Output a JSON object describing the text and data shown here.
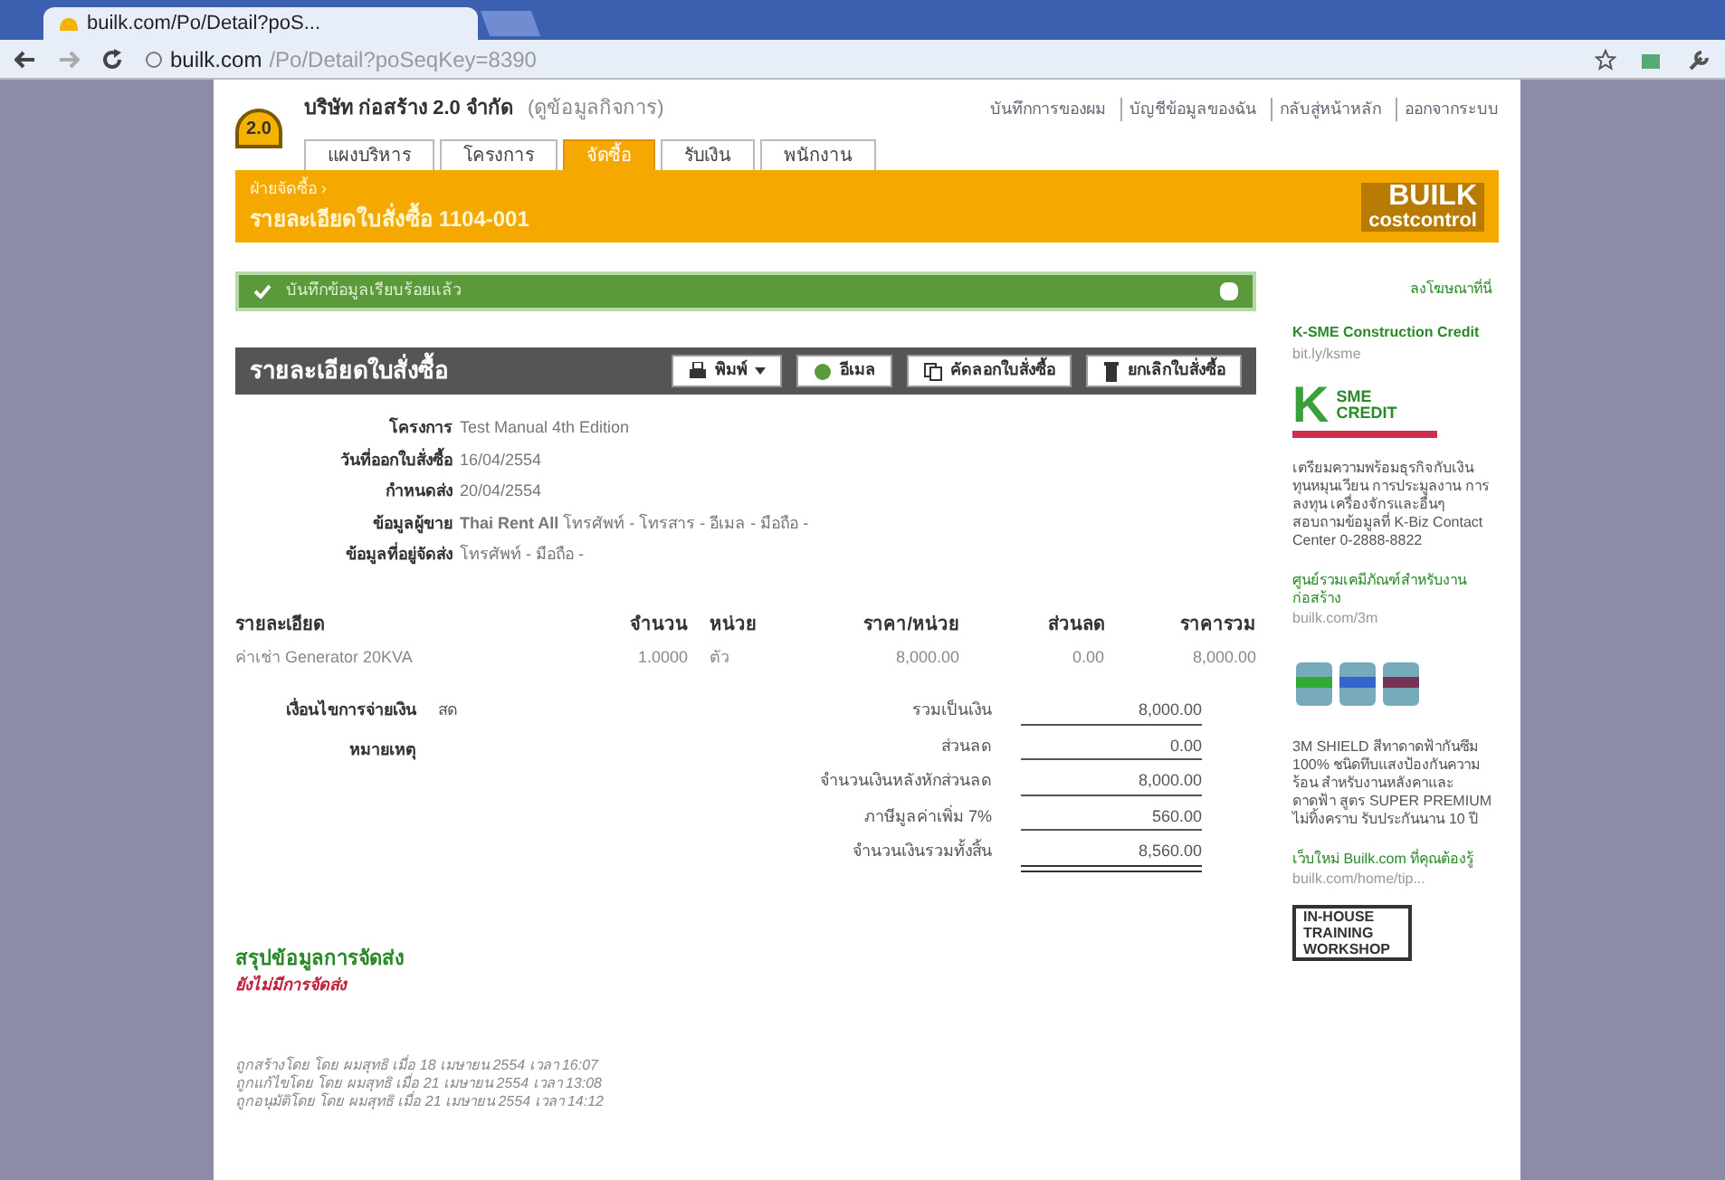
{
  "browser": {
    "tab_title": "builk.com/Po/Detail?poS...",
    "url_host": "builk.com",
    "url_path": "/Po/Detail?poSeqKey=8390"
  },
  "header": {
    "logo_badge": "2.0",
    "company": "บริษัท ก่อสร้าง 2.0 จำกัด",
    "company_link": "(ดูข้อมูลกิจการ)",
    "top_links": [
      "บันทึกการของผม",
      "บัญชีข้อมูลของฉัน",
      "กลับสู่หน้าหลัก",
      "ออกจากระบบ"
    ],
    "tabs": [
      {
        "label": "แผงบริหาร",
        "selected": false
      },
      {
        "label": "โครงการ",
        "selected": false
      },
      {
        "label": "จัดซื้อ",
        "selected": true
      },
      {
        "label": "รับเงิน",
        "selected": false
      },
      {
        "label": "พนักงาน",
        "selected": false
      }
    ],
    "breadcrumb": "ฝ่ายจัดซื้อ ›",
    "page_title": "รายละเอียดใบสั่งซื้อ 1104-001",
    "brand_top": "BUILK",
    "brand_bottom": "costcontrol"
  },
  "alert": {
    "text": "บันทึกข้อมูลเรียบร้อยแล้ว"
  },
  "panel": {
    "title": "รายละเอียดใบสั่งซื้อ",
    "buttons": [
      {
        "label": "พิมพ์",
        "kind": "print"
      },
      {
        "label": "อีเมล",
        "kind": "email"
      },
      {
        "label": "คัดลอกใบสั่งซื้อ",
        "kind": "copy"
      },
      {
        "label": "ยกเลิกใบสั่งซื้อ",
        "kind": "delete"
      }
    ]
  },
  "fields": [
    {
      "label": "โครงการ",
      "value": "Test Manual 4th Edition"
    },
    {
      "label": "วันที่ออกใบสั่งซื้อ",
      "value": "16/04/2554"
    },
    {
      "label": "กำหนดส่ง",
      "value": "20/04/2554"
    },
    {
      "label": "ข้อมูลผู้ขาย",
      "value": "**Thai Rent All** โทรศัพท์ - โทรสาร - อีเมล - มือถือ -"
    },
    {
      "label": "ข้อมูลที่อยู่จัดส่ง",
      "value": "โทรศัพท์ - มือถือ -"
    }
  ],
  "table": {
    "columns": [
      "รายละเอียด",
      "จำนวน",
      "หน่วย",
      "ราคา/หน่วย",
      "ส่วนลด",
      "ราคารวม"
    ],
    "rows": [
      [
        "ค่าเช่า Generator 20KVA",
        "1.0000",
        "ตัว",
        "8,000.00",
        "0.00",
        "8,000.00"
      ]
    ]
  },
  "terms": [
    {
      "label": "เงื่อนไขการจ่ายเงิน",
      "value": "สด"
    },
    {
      "label": "หมายเหตุ"
    }
  ],
  "totals": [
    {
      "label": "รวมเป็นเงิน",
      "value": "8,000.00"
    },
    {
      "label": "ส่วนลด",
      "value": "0.00"
    },
    {
      "label": "จำนวนเงินหลังหักส่วนลด",
      "value": "8,000.00"
    },
    {
      "label": "ภาษีมูลค่าเพิ่ม 7%",
      "value": "560.00"
    },
    {
      "label": "จำนวนเงินรวมทั้งสิ้น",
      "value": "8,560.00"
    }
  ],
  "delivery": {
    "title": "สรุปข้อมูลการจัดส่ง",
    "status": "ยังไม่มีการจัดส่ง"
  },
  "log": [
    "ถูกสร้างโดย โดย ผมสุทธิ เมื่อ 18 เมษายน 2554 เวลา 16:07",
    "ถูกแก้ไขโดย โดย ผมสุทธิ เมื่อ 21 เมษายน 2554 เวลา 13:08",
    "ถูกอนุมัติโดย โดย ผมสุทธิ เมื่อ 21 เมษายน 2554 เวลา 14:12"
  ],
  "sidebar": {
    "heading": "ลงโฆษณาที่นี่",
    "ads": [
      {
        "kind": "ksme",
        "title": "K-SME Construction Credit",
        "url": "bit.ly/ksme",
        "logo_mark": "K",
        "logo_top": "SME",
        "logo_bottom": "CREDIT",
        "text": "เตรียมความพร้อมธุรกิจกับเงินทุนหมุนเวียน การประมูลงาน การลงทุน เครื่องจักรและอื่นๆ สอบถามข้อมูลที่ K-Biz Contact Center 0-2888-8822"
      },
      {
        "kind": "paint",
        "title": "ศูนย์รวมเคมีภัณฑ์สำหรับงานก่อสร้าง",
        "url": "builk.com/3m",
        "text": "3M SHIELD สีทาดาดฟ้ากันซึม 100% ชนิดทึบแสงป้องกันความร้อน สำหรับงานหลังคาและดาดฟ้า สูตร SUPER PREMIUM ไม่ทิ้งคราบ รับประกันนาน 10 ปี"
      },
      {
        "kind": "training",
        "title": "เว็บใหม่ Builk.com ที่คุณต้องรู้",
        "url": "builk.com/home/tip...",
        "logo_lines": [
          "IN-HOUSE",
          "TRAINING",
          "WORKSHOP"
        ]
      }
    ]
  }
}
